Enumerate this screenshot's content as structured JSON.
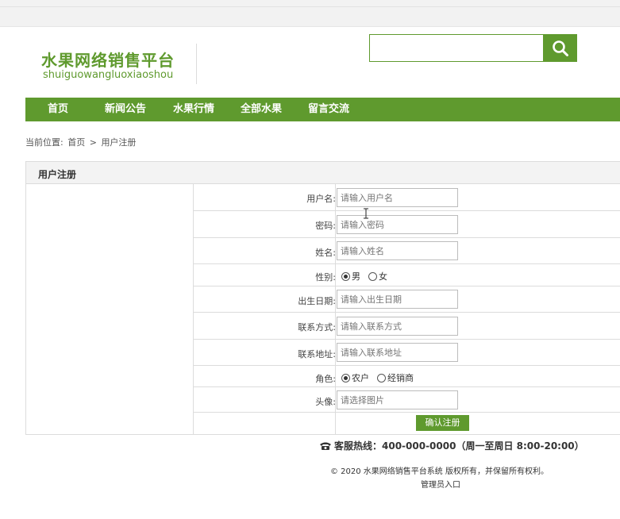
{
  "header": {
    "logo_title": "水果网络销售平台",
    "logo_subtitle": "shuiguowangluoxiaoshou",
    "search_placeholder": "",
    "search_icon": "search-icon"
  },
  "nav": {
    "items": [
      {
        "label": "首页"
      },
      {
        "label": "新闻公告"
      },
      {
        "label": "水果行情"
      },
      {
        "label": "全部水果"
      },
      {
        "label": "留言交流"
      }
    ]
  },
  "breadcrumb": {
    "prefix": "当前位置:",
    "home": "首页",
    "separator": ">",
    "current": "用户注册"
  },
  "panel": {
    "title": "用户注册"
  },
  "form": {
    "username": {
      "label": "用户名:",
      "placeholder": "请输入用户名"
    },
    "password": {
      "label": "密码:",
      "placeholder": "请输入密码"
    },
    "name": {
      "label": "姓名:",
      "placeholder": "请输入姓名"
    },
    "gender": {
      "label": "性别:",
      "options": [
        "男",
        "女"
      ],
      "selected": "男"
    },
    "birthdate": {
      "label": "出生日期:",
      "placeholder": "请输入出生日期"
    },
    "contact": {
      "label": "联系方式:",
      "placeholder": "请输入联系方式"
    },
    "address": {
      "label": "联系地址:",
      "placeholder": "请输入联系地址"
    },
    "role": {
      "label": "角色:",
      "options": [
        "农户",
        "经销商"
      ],
      "selected": "农户"
    },
    "avatar": {
      "label": "头像:",
      "placeholder": "请选择图片"
    },
    "submit_label": "确认注册"
  },
  "footer": {
    "hotline": "客服热线：400-000-0000（周一至周日 8:00-20:00）",
    "copyright": "© 2020 水果网络销售平台系统 版权所有，并保留所有权利。",
    "admin_link": "管理员入口"
  },
  "colors": {
    "brand_green": "#5f9a2e",
    "panel_header_bg": "#f3f3f3",
    "border": "#dcdcdc"
  }
}
